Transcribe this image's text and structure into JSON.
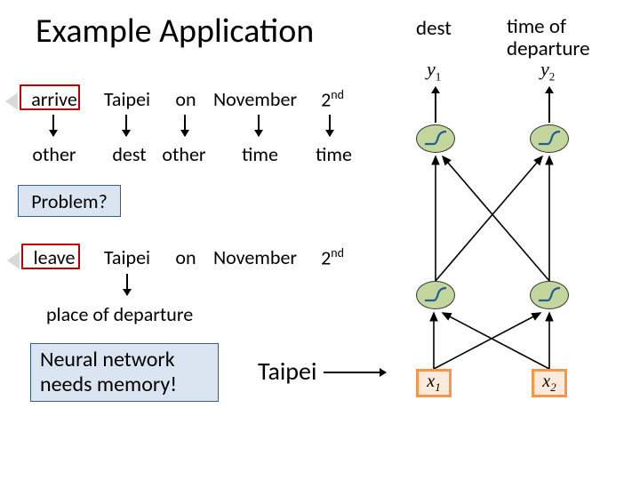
{
  "title": "Example Application",
  "top": {
    "dest": "dest",
    "tod": "time of departure"
  },
  "row1": {
    "w1": "arrive",
    "w2": "Taipei",
    "w3": "on",
    "w4": "November",
    "w5_num": "2",
    "w5_suf": "nd"
  },
  "row2": {
    "w1": "other",
    "w2": "dest",
    "w3": "other",
    "w4": "time",
    "w5": "time"
  },
  "problem": "Problem?",
  "row3": {
    "w1": "leave",
    "w2": "Taipei",
    "w3": "on",
    "w4": "November",
    "w5_num": "2",
    "w5_suf": "nd"
  },
  "pod": "place of departure",
  "mem": "Neural network needs memory!",
  "taipei": "Taipei",
  "nn": {
    "y1_base": "y",
    "y1_sub": "1",
    "y2_base": "y",
    "y2_sub": "2",
    "x1_base": "x",
    "x1_sub": "1",
    "x2_base": "x",
    "x2_sub": "2"
  }
}
